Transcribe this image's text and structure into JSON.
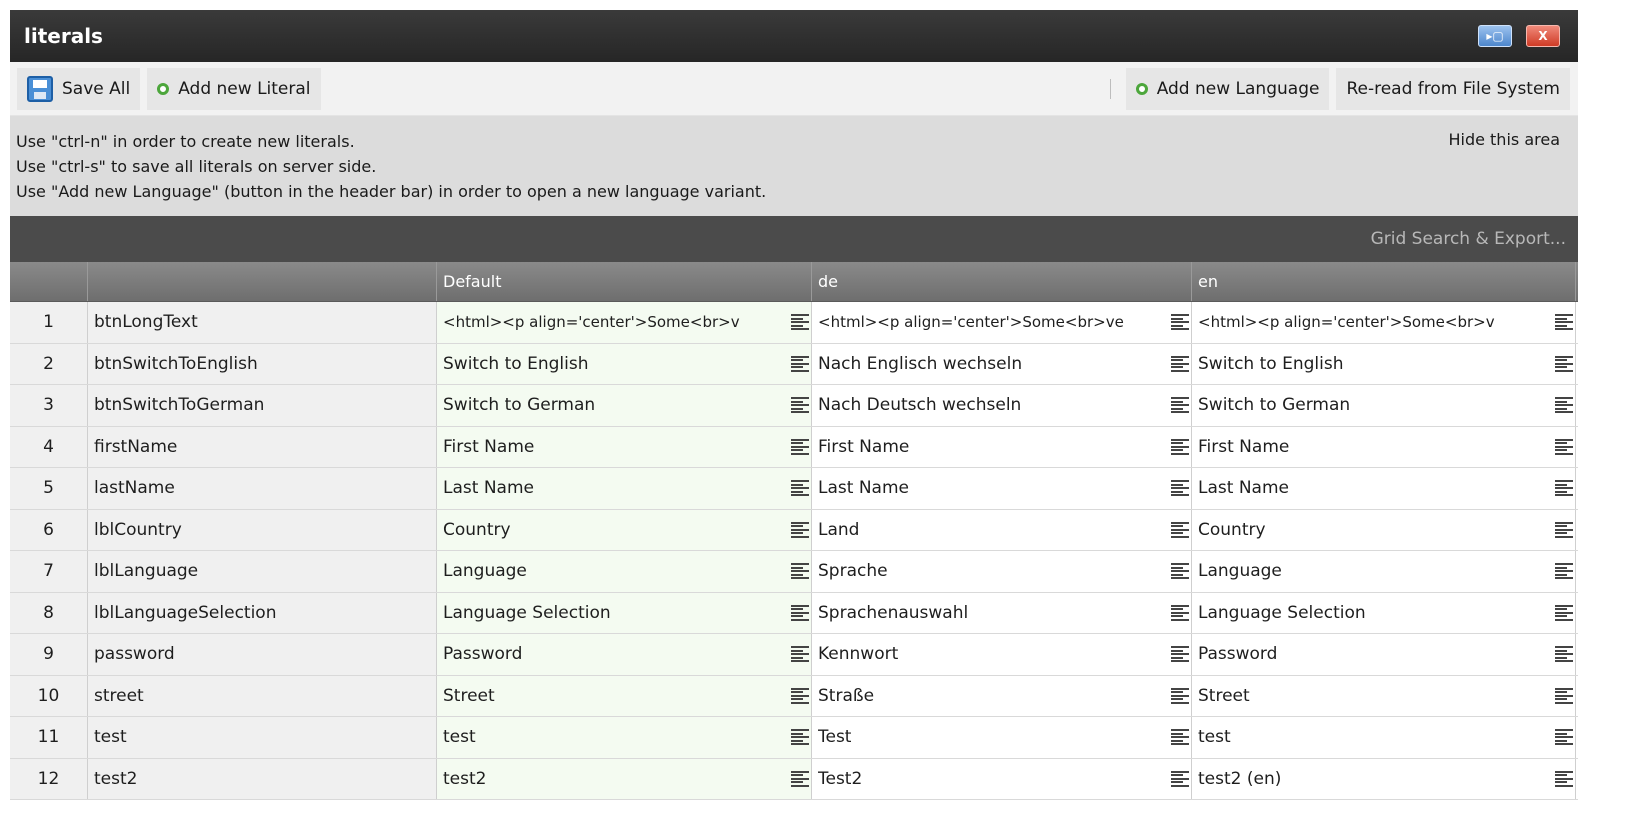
{
  "window": {
    "title": "literals",
    "maximize_icon": "maximize-icon",
    "close_icon": "close-icon",
    "close_label": "X",
    "maximize_label": "▸▢"
  },
  "toolbar": {
    "save_all": "Save All",
    "add_literal": "Add new Literal",
    "add_language": "Add new Language",
    "reread": "Re-read from File System"
  },
  "info": {
    "lines": [
      "Use \"ctrl-n\" in order to create new literals.",
      "Use \"ctrl-s\" to save all literals on server side.",
      "Use \"Add new Language\" (button in the header bar) in order to open a new language variant."
    ],
    "hide": "Hide this area"
  },
  "grid": {
    "search_export": "Grid Search & Export...",
    "columns": [
      "",
      "",
      "Default",
      "de",
      "en"
    ],
    "rows": [
      {
        "num": "1",
        "key": "btnLongText",
        "default": "<html><p align='center'>Some<br>v",
        "de": "<html><p align='center'>Some<br>ve",
        "en": "<html><p align='center'>Some<br>v"
      },
      {
        "num": "2",
        "key": "btnSwitchToEnglish",
        "default": "Switch to English",
        "de": "Nach Englisch wechseln",
        "en": "Switch to English"
      },
      {
        "num": "3",
        "key": "btnSwitchToGerman",
        "default": "Switch to German",
        "de": "Nach Deutsch wechseln",
        "en": "Switch to German"
      },
      {
        "num": "4",
        "key": "firstName",
        "default": "First Name",
        "de": "First Name",
        "en": "First Name"
      },
      {
        "num": "5",
        "key": "lastName",
        "default": "Last Name",
        "de": "Last Name",
        "en": "Last Name"
      },
      {
        "num": "6",
        "key": "lblCountry",
        "default": "Country",
        "de": "Land",
        "en": "Country"
      },
      {
        "num": "7",
        "key": "lblLanguage",
        "default": "Language",
        "de": "Sprache",
        "en": "Language"
      },
      {
        "num": "8",
        "key": "lblLanguageSelection",
        "default": "Language Selection",
        "de": "Sprachenauswahl",
        "en": "Language Selection"
      },
      {
        "num": "9",
        "key": "password",
        "default": "Password",
        "de": "Kennwort",
        "en": "Password"
      },
      {
        "num": "10",
        "key": "street",
        "default": "Street",
        "de": "Straße",
        "en": "Street"
      },
      {
        "num": "11",
        "key": "test",
        "default": "test",
        "de": "Test",
        "en": "test"
      },
      {
        "num": "12",
        "key": "test2",
        "default": "test2",
        "de": "Test2",
        "en": "test2 (en)"
      }
    ]
  }
}
